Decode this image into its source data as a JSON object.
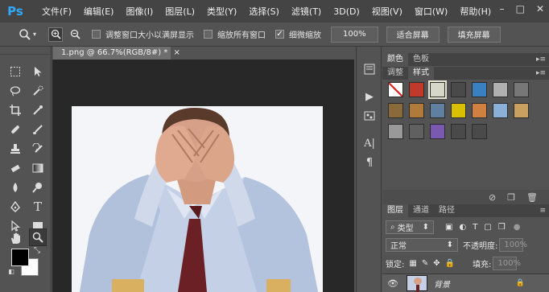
{
  "app": {
    "logo": "Ps"
  },
  "menu": [
    "文件(F)",
    "编辑(E)",
    "图像(I)",
    "图层(L)",
    "类型(Y)",
    "选择(S)",
    "滤镜(T)",
    "3D(D)",
    "视图(V)",
    "窗口(W)",
    "帮助(H)"
  ],
  "window_controls": {
    "minimize": "–",
    "maximize": "□",
    "close": "✕"
  },
  "options": {
    "tool_icon": "zoom-icon",
    "resize_windows": "调整窗口大小以满屏显示",
    "zoom_all_windows": "缩放所有窗口",
    "scrubby_zoom": "细微缩放",
    "scrubby_checked": true,
    "btn_100": "100%",
    "btn_fit": "适合屏幕",
    "btn_fill": "填充屏幕"
  },
  "document": {
    "tab_title": "1.png @ 66.7%(RGB/8#) *",
    "close": "×"
  },
  "panels": {
    "color_tab": "颜色",
    "swatches_tab": "色板",
    "adjust_tab": "调整",
    "styles_tab": "样式",
    "styles": [
      "#ffffff",
      "#c0392b",
      "#d8d8c8",
      "#4a4a4a",
      "#3a7fc0",
      "#b0b0b0",
      "#777777",
      "#8a6a3a",
      "#b07a3a",
      "#6080a0",
      "#d8c000",
      "#d08040",
      "#8ab0d8",
      "#caa060",
      "#999999",
      "#606060",
      "#7a5ab0",
      "#4a4a4a",
      "#4a4a4a"
    ],
    "layers_tab": "图层",
    "channels_tab": "通道",
    "paths_tab": "路径",
    "filter_label": "类型",
    "blend_mode": "正常",
    "opacity_label": "不透明度:",
    "opacity_value": "100%",
    "lock_label": "锁定:",
    "fill_label": "填充:",
    "fill_value": "100%",
    "layer_name": "背景"
  }
}
